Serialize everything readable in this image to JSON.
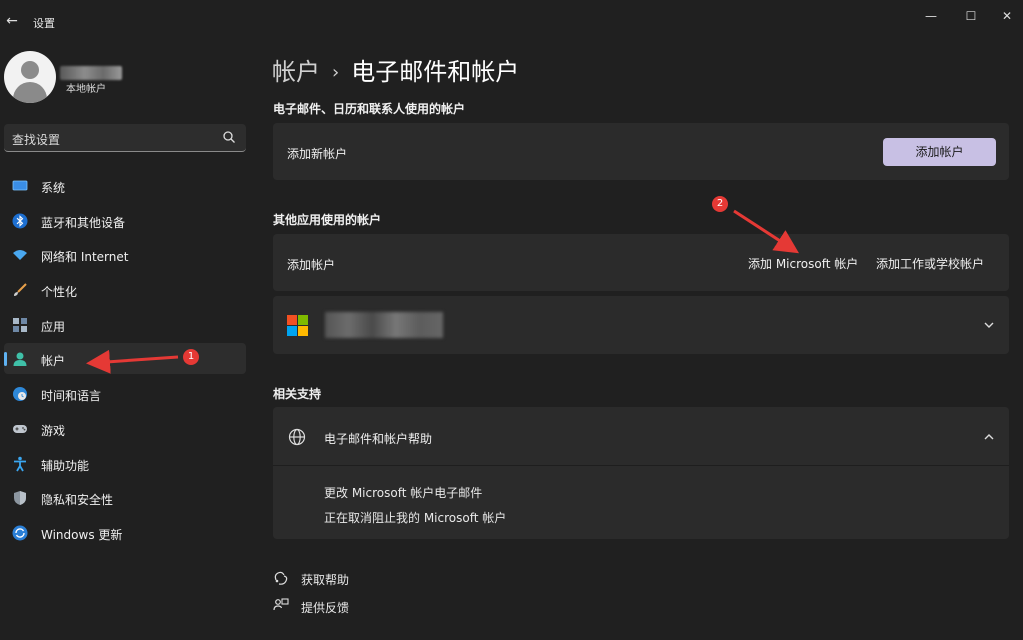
{
  "window": {
    "title": "设置",
    "back_glyph": "←",
    "minimize_glyph": "—",
    "maximize_glyph": "☐",
    "close_glyph": "✕"
  },
  "profile": {
    "account_type": "本地帐户"
  },
  "search": {
    "placeholder": "查找设置"
  },
  "sidebar": {
    "items": [
      {
        "label": "系统",
        "icon": "system-icon"
      },
      {
        "label": "蓝牙和其他设备",
        "icon": "bluetooth-icon"
      },
      {
        "label": "网络和 Internet",
        "icon": "wifi-icon"
      },
      {
        "label": "个性化",
        "icon": "brush-icon"
      },
      {
        "label": "应用",
        "icon": "apps-icon"
      },
      {
        "label": "帐户",
        "icon": "account-icon",
        "active": true
      },
      {
        "label": "时间和语言",
        "icon": "clock-globe-icon"
      },
      {
        "label": "游戏",
        "icon": "gamepad-icon"
      },
      {
        "label": "辅助功能",
        "icon": "accessibility-icon"
      },
      {
        "label": "隐私和安全性",
        "icon": "shield-icon"
      },
      {
        "label": "Windows 更新",
        "icon": "update-icon"
      }
    ]
  },
  "breadcrumb": {
    "parent": "帐户",
    "separator": "›",
    "current": "电子邮件和帐户"
  },
  "email_section": {
    "title": "电子邮件、日历和联系人使用的帐户",
    "add_new_label": "添加新帐户",
    "add_button": "添加帐户"
  },
  "other_apps_section": {
    "title": "其他应用使用的帐户",
    "add_label": "添加帐户",
    "add_microsoft": "添加 Microsoft 帐户",
    "add_work_school": "添加工作或学校帐户"
  },
  "related_support": {
    "title": "相关支持",
    "help_header": "电子邮件和帐户帮助",
    "links": [
      "更改 Microsoft 帐户电子邮件",
      "正在取消阻止我的 Microsoft 帐户"
    ]
  },
  "footer": {
    "get_help": "获取帮助",
    "feedback": "提供反馈"
  },
  "annotations": {
    "badge_1": "1",
    "badge_2": "2"
  },
  "colors": {
    "background": "#202020",
    "card": "#2b2b2b",
    "accent": "#5fb2f2",
    "primary_button": "#c8c0e4",
    "annotation": "#e53935"
  }
}
